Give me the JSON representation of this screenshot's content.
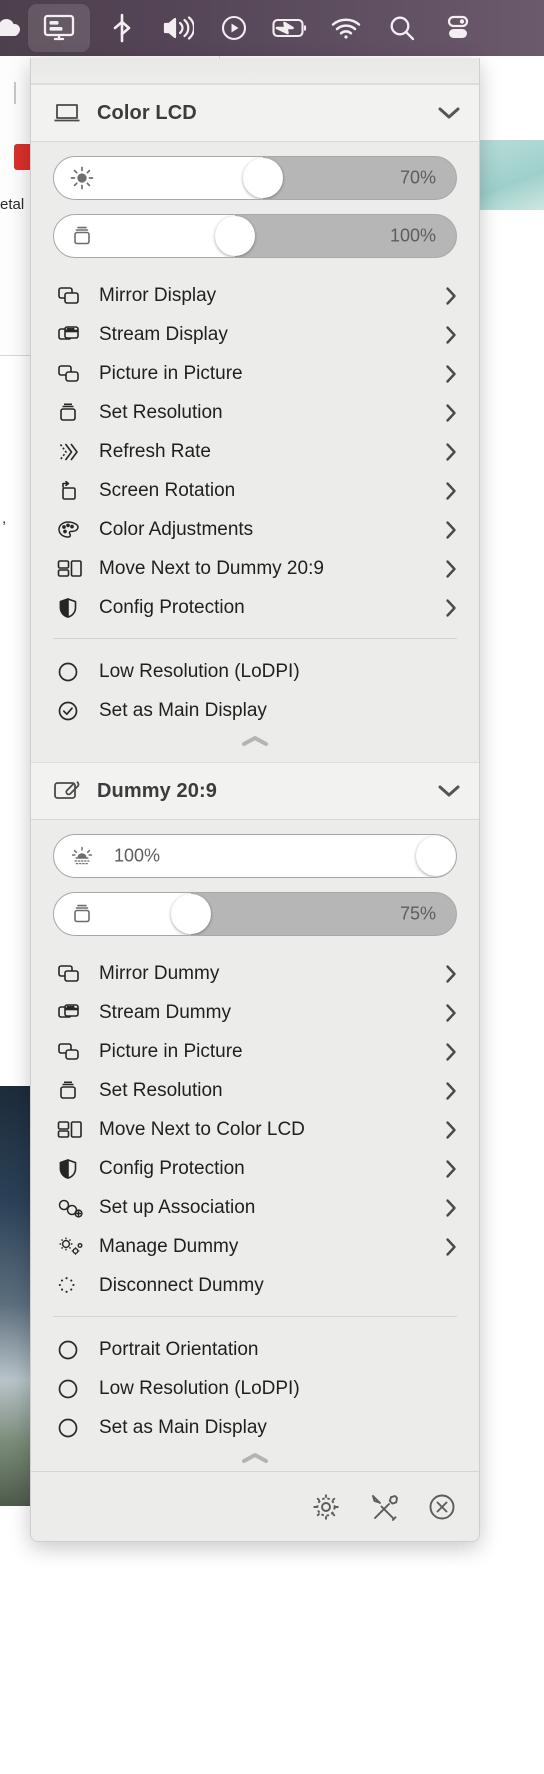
{
  "menubar": {
    "items": [
      {
        "name": "cloud-icon",
        "label": "Cloud"
      },
      {
        "name": "display-manager-icon",
        "label": "Display Manager",
        "active": true
      },
      {
        "name": "bluetooth-icon",
        "label": "Bluetooth"
      },
      {
        "name": "volume-icon",
        "label": "Volume"
      },
      {
        "name": "play-icon",
        "label": "Now Playing"
      },
      {
        "name": "battery-charging-icon",
        "label": "Battery"
      },
      {
        "name": "wifi-icon",
        "label": "Wi-Fi"
      },
      {
        "name": "search-icon",
        "label": "Spotlight Search"
      },
      {
        "name": "control-center-icon",
        "label": "Control Center"
      }
    ]
  },
  "desktop": {
    "text_fragment_1": "etal",
    "text_fragment_2": ","
  },
  "panel": {
    "sections": [
      {
        "id": "color-lcd",
        "icon": "laptop-display-icon",
        "title": "Color LCD",
        "chevron": "chevron-down-icon",
        "sliders": [
          {
            "id": "brightness",
            "icon": "brightness-sun-icon",
            "value_label": "70%",
            "percent": 70,
            "value_position": "right"
          },
          {
            "id": "contrast",
            "icon": "contrast-icon",
            "value_label": "100%",
            "percent": 45,
            "value_position": "right"
          }
        ],
        "items": [
          {
            "icon": "mirror-display-icon",
            "label": "Mirror Display",
            "arrow": true
          },
          {
            "icon": "stream-display-icon",
            "label": "Stream Display",
            "arrow": true
          },
          {
            "icon": "picture-in-picture-icon",
            "label": "Picture in Picture",
            "arrow": true
          },
          {
            "icon": "set-resolution-icon",
            "label": "Set Resolution",
            "arrow": true
          },
          {
            "icon": "refresh-rate-icon",
            "label": "Refresh Rate",
            "arrow": true
          },
          {
            "icon": "screen-rotation-icon",
            "label": "Screen Rotation",
            "arrow": true
          },
          {
            "icon": "color-adjustments-icon",
            "label": "Color Adjustments",
            "arrow": true
          },
          {
            "icon": "move-next-to-icon",
            "label": "Move Next to Dummy 20:9",
            "arrow": true
          },
          {
            "icon": "shield-icon",
            "label": "Config Protection",
            "arrow": true
          }
        ],
        "toggles": [
          {
            "icon": "circle-unchecked-icon",
            "label": "Low Resolution (LoDPI)",
            "checked": false
          },
          {
            "icon": "circle-checked-icon",
            "label": "Set as Main Display",
            "checked": true
          }
        ],
        "collapse_icon": "chevron-up-collapse-icon"
      },
      {
        "id": "dummy-20-9",
        "icon": "dummy-display-icon",
        "title": "Dummy 20:9",
        "chevron": "chevron-down-icon",
        "sliders": [
          {
            "id": "brightness",
            "icon": "brightness-sunrise-icon",
            "value_label": "100%",
            "percent": 100,
            "value_position": "left"
          },
          {
            "id": "contrast",
            "icon": "contrast-icon",
            "value_label": "75%",
            "percent": 34,
            "value_position": "right"
          }
        ],
        "items": [
          {
            "icon": "mirror-display-icon",
            "label": "Mirror Dummy",
            "arrow": true
          },
          {
            "icon": "stream-display-icon",
            "label": "Stream Dummy",
            "arrow": true
          },
          {
            "icon": "picture-in-picture-icon",
            "label": "Picture in Picture",
            "arrow": true
          },
          {
            "icon": "set-resolution-icon",
            "label": "Set Resolution",
            "arrow": true
          },
          {
            "icon": "move-next-to-icon",
            "label": "Move Next to Color LCD",
            "arrow": true
          },
          {
            "icon": "shield-icon",
            "label": "Config Protection",
            "arrow": true
          },
          {
            "icon": "set-up-association-icon",
            "label": "Set up Association",
            "arrow": true
          },
          {
            "icon": "manage-dummy-icon",
            "label": "Manage Dummy",
            "arrow": true
          },
          {
            "icon": "disconnect-dummy-icon",
            "label": "Disconnect Dummy",
            "arrow": false
          }
        ],
        "toggles": [
          {
            "icon": "circle-unchecked-icon",
            "label": "Portrait Orientation",
            "checked": false
          },
          {
            "icon": "circle-unchecked-icon",
            "label": "Low Resolution (LoDPI)",
            "checked": false
          },
          {
            "icon": "circle-unchecked-icon",
            "label": "Set as Main Display",
            "checked": false
          }
        ],
        "collapse_icon": "chevron-up-collapse-icon"
      }
    ],
    "footer": {
      "buttons": [
        {
          "icon": "gear-icon",
          "label": "Settings"
        },
        {
          "icon": "tools-icon",
          "label": "Tools"
        },
        {
          "icon": "quit-icon",
          "label": "Quit"
        }
      ]
    }
  },
  "colors": {
    "menubar_accent": "#564759",
    "panel_bg": "#ececeb",
    "header_bg": "#f2f2f1",
    "slider_track": "#b6b6b6",
    "slider_fill": "#ffffff",
    "text": "#1f1f1f"
  }
}
